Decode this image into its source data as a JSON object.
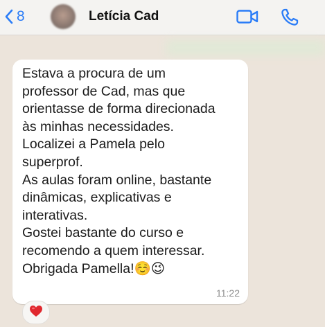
{
  "header": {
    "back_count": "8",
    "contact_name": "Letícia Cad"
  },
  "message": {
    "text": "Estava a procura de um\nprofessor de Cad, mas que\norientasse de forma direcionada\nàs minhas necessidades.\nLocalizei a Pamela pelo\nsuperprof.\nAs aulas foram online, bastante\ndinâmicas, explicativas e\ninterativas.\nGostei bastante do curso e\nrecomendo a quem interessar.\nObrigada Pamella!☺️😉",
    "time": "11:22",
    "reaction": "heart-emoji"
  },
  "colors": {
    "accent": "#2a7cf7",
    "background": "#ece4db",
    "bubble": "#ffffff",
    "reaction_heart": "#e0282e"
  },
  "icons": {
    "back": "chevron-left-icon",
    "video": "video-camera-icon",
    "call": "phone-icon"
  }
}
